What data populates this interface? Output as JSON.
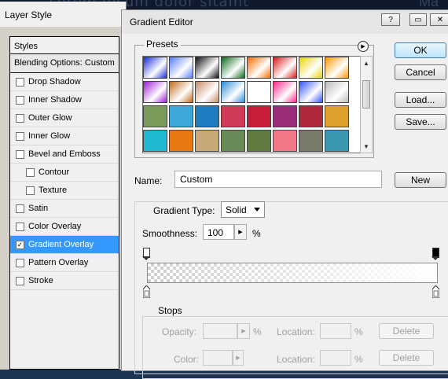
{
  "background": {
    "text": "Lorem ipsum dolor sitamt",
    "text_right": "Ma"
  },
  "layer_style": {
    "title": "Layer Style",
    "styles_header": "Styles",
    "blending_options": "Blending Options: Custom",
    "items": [
      {
        "label": "Drop Shadow",
        "checked": ""
      },
      {
        "label": "Inner Shadow",
        "checked": ""
      },
      {
        "label": "Outer Glow",
        "checked": ""
      },
      {
        "label": "Inner Glow",
        "checked": ""
      },
      {
        "label": "Bevel and Emboss",
        "checked": ""
      },
      {
        "label": "Contour",
        "checked": ""
      },
      {
        "label": "Texture",
        "checked": ""
      },
      {
        "label": "Satin",
        "checked": ""
      },
      {
        "label": "Color Overlay",
        "checked": ""
      },
      {
        "label": "Gradient Overlay",
        "checked": "✓"
      },
      {
        "label": "Pattern Overlay",
        "checked": ""
      },
      {
        "label": "Stroke",
        "checked": ""
      }
    ]
  },
  "gradient_editor": {
    "title": "Gradient Editor",
    "window_controls": {
      "help": "?",
      "minimize": "▭",
      "close": "✕"
    },
    "presets_label": "Presets",
    "presets_menu_icon": "▶",
    "buttons": {
      "ok": "OK",
      "cancel": "Cancel",
      "load": "Load...",
      "save": "Save...",
      "new": "New"
    },
    "name_label": "Name:",
    "name_value": "Custom",
    "gradient_type_label": "Gradient Type:",
    "gradient_type_value": "Solid",
    "smoothness_label": "Smoothness:",
    "smoothness_value": "100",
    "smoothness_unit": "%",
    "stops": {
      "label": "Stops",
      "opacity_label": "Opacity:",
      "opacity_unit": "%",
      "color_label": "Color:",
      "location_label": "Location:",
      "location_unit": "%",
      "delete_label": "Delete"
    },
    "swatch_colors": [
      "#1a2fd6",
      "#5a7cff",
      "#111111",
      "#0b6b1c",
      "#ff6a00",
      "#d41d1d",
      "#e8d400",
      "#ff9900",
      "#9b1dd6",
      "#c06a20",
      "#c98a6a",
      "#2a8fd8",
      "#ffffff",
      "#ff2a8a",
      "#3355ff",
      "#bbbbbb",
      "#7a9a5a",
      "#3ba8d8",
      "#1e7dc0",
      "#d23a5a",
      "#c81e3c",
      "#9a2e7a",
      "#b0283c",
      "#e0a030",
      "#20b8d0",
      "#e87810",
      "#c8a878",
      "#6a8a58",
      "#607a40",
      "#f07888",
      "#7a7a68",
      "#3a98b0"
    ]
  }
}
